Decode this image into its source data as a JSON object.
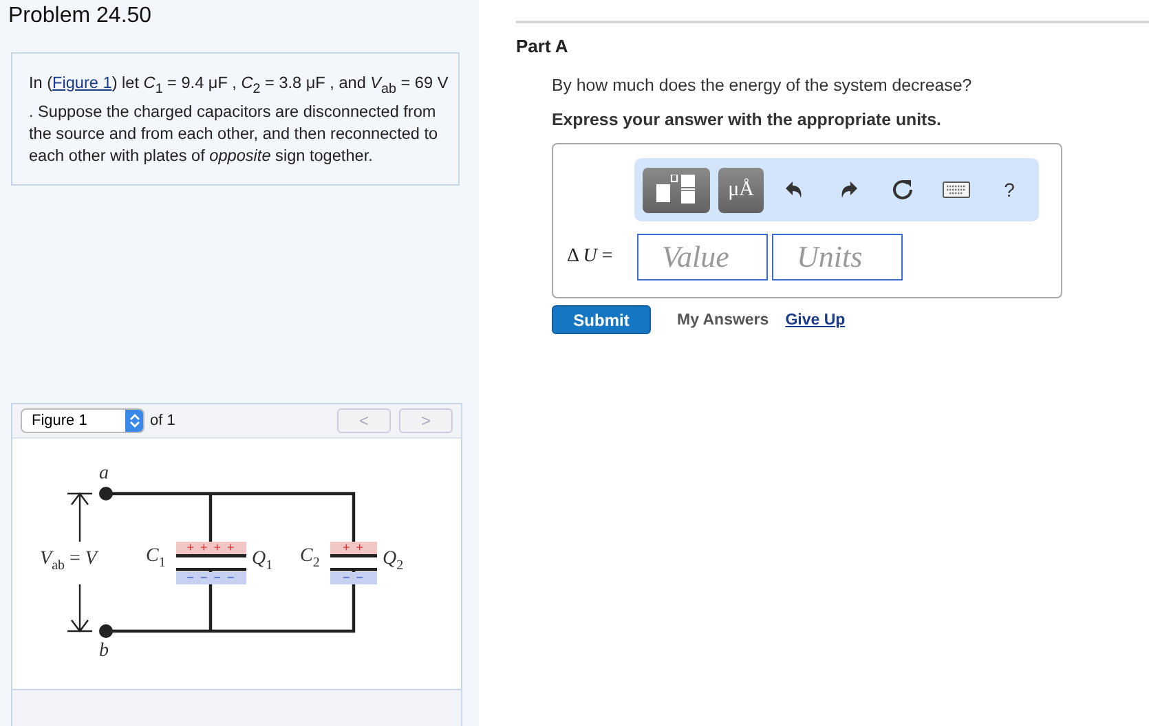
{
  "problem": {
    "title": "Problem 24.50",
    "text_before": "In (",
    "link": "Figure 1",
    "text_after": ") let *C*$_{1}$ = 9.4 μF , *C*$_{2}$ = 3.8 μF , and *V*$_{ab}$ = 69 V . Suppose the charged capacitors are disconnected from the source and from each other, and then reconnected to each other with plates of *opposite* sign together."
  },
  "figure": {
    "selector": "Figure 1",
    "count": "of 1",
    "nav": [
      {
        "label": "<",
        "disabled": true
      },
      {
        "label": ">",
        "disabled": true
      }
    ],
    "circuit": {
      "node_top": "a",
      "node_bottom": "b",
      "voltage_label": "*V*$_{ab}$ = *V*",
      "capacitors": [
        {
          "name": "*C*$_{1}$",
          "charge": "*Q*$_{1}$",
          "positive": "+ + + +",
          "negative": "− − − −"
        },
        {
          "name": "*C*$_{2}$",
          "charge": "*Q*$_{2}$",
          "positive": "+ +",
          "negative": "− −"
        }
      ]
    }
  },
  "part": {
    "title": "Part A",
    "question": "By how much does the energy of the system decrease?",
    "instruction": "Express your answer with the appropriate units.",
    "toolbar": [
      {
        "kind": "templates"
      },
      {
        "kind": "units",
        "label": "μÅ"
      },
      {
        "kind": "undo"
      },
      {
        "kind": "redo"
      },
      {
        "kind": "reset"
      },
      {
        "kind": "keyboard"
      },
      {
        "kind": "help",
        "label": "?"
      }
    ],
    "answer_label": "Δ *U* =",
    "value_placeholder": "Value",
    "units_placeholder": "Units",
    "submit": "Submit",
    "my_answers": "My Answers",
    "give_up": "Give Up"
  }
}
